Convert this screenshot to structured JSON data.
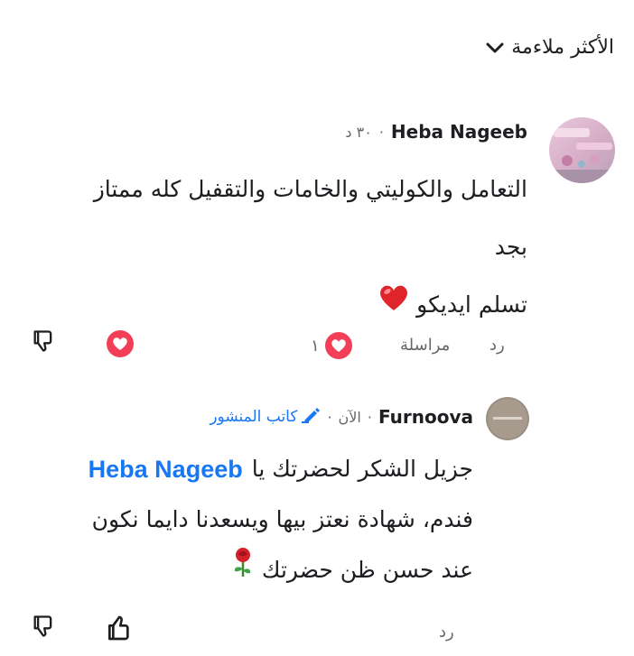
{
  "sort": {
    "label": "الأكثر ملاءمة"
  },
  "comments": [
    {
      "author": "Heba Nageeb",
      "time": "٣٠ د",
      "lines": [
        "التعامل والكوليتي والخامات والتقفيل كله ممتاز",
        "بجد",
        "تسلم ايديكو"
      ],
      "reaction_count": "١",
      "actions": {
        "reply": "رد",
        "message": "مراسلة"
      }
    },
    {
      "author": "Furnoova",
      "time": "الآن",
      "author_badge": "كاتب المنشور",
      "line1_prefix": "جزيل الشكر لحضرتك يا",
      "mention": "Heba Nageeb",
      "line2": "فندم، شهادة نعتز بيها ويسعدنا دايما نكون",
      "line3": "عند حسن ظن حضرتك",
      "actions": {
        "reply": "رد"
      }
    }
  ],
  "colors": {
    "accent": "#1877f2",
    "heart": "#f33e58",
    "text": "#1c1e21",
    "muted": "#65676b"
  }
}
